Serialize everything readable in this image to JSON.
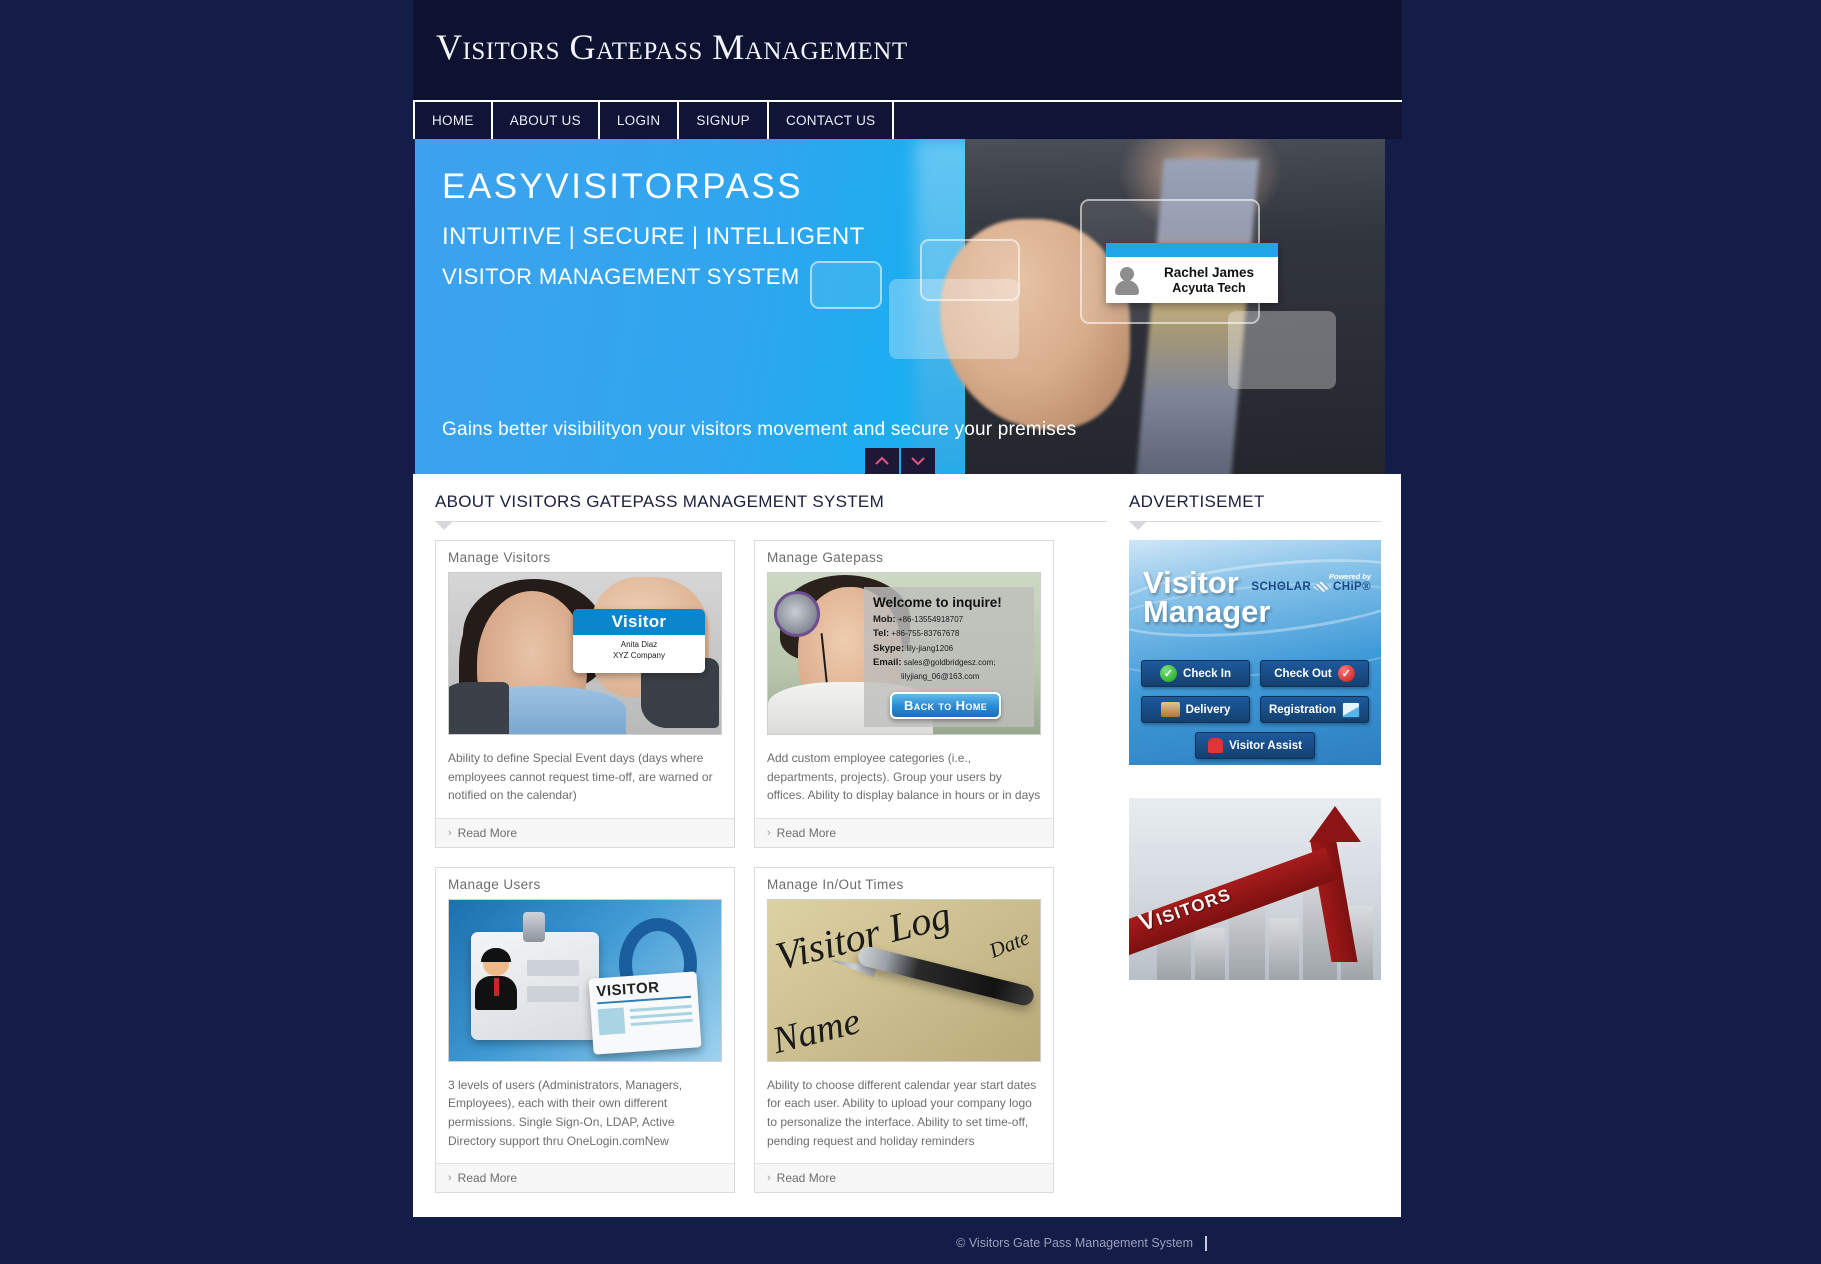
{
  "header": {
    "title": "Visitors Gatepass Management"
  },
  "nav": {
    "items": [
      {
        "label": "HOME"
      },
      {
        "label": "ABOUT US"
      },
      {
        "label": "LOGIN"
      },
      {
        "label": "SIGNUP"
      },
      {
        "label": "CONTACT US"
      }
    ]
  },
  "hero": {
    "title": "EASYVISITORPASS",
    "subtitle1": "INTUITIVE | SECURE | INTELLIGENT",
    "subtitle2": "VISITOR MANAGEMENT SYSTEM",
    "tagline": "Gains better visibilityon your visitors movement and secure your premises",
    "badge": {
      "name": "Rachel James",
      "org": "Acyuta Tech"
    },
    "controls": {
      "prev": "∧",
      "next": "∨"
    }
  },
  "main": {
    "section_title": "ABOUT VISITORS GATEPASS MANAGEMENT SYSTEM",
    "read_more_label": "Read More",
    "chevron": "›",
    "cards": [
      {
        "title": "Manage Visitors",
        "description": "Ability to define Special Event days (days where employees cannot request time-off, are warned or notified on the calendar)",
        "image": {
          "alt": "woman-holding-visitor-card",
          "card_label": "Visitor",
          "card_name": "Anita Diaz",
          "card_org": "XYZ Company"
        }
      },
      {
        "title": "Manage Gatepass",
        "description": "Add custom employee categories (i.e., departments, projects). Group your users by offices. Ability to display balance in hours or in days",
        "image": {
          "alt": "call-center-agent-inquire-panel",
          "heading": "Welcome to inquire!",
          "mob_label": "Mob:",
          "mob": "+86-13554918707",
          "tel_label": "Tel:",
          "tel": "+86-755-83767678",
          "skype_label": "Skype:",
          "skype": "lily-jiang1206",
          "email_label": "Email:",
          "email1": "sales@goldbridgesz.com;",
          "email2": "lilyjiang_06@163.com",
          "button": "Back to Home"
        }
      },
      {
        "title": "Manage Users",
        "description": "3 levels of users (Administrators, Managers, Employees), each with their own different permissions. Single Sign-On, LDAP, Active Directory support thru OneLogin.comNew",
        "image": {
          "alt": "id-badge-lanyard",
          "badge_label": "VISITOR"
        }
      },
      {
        "title": "Manage In/Out Times",
        "description": "Ability to choose different calendar year start dates for each user. Ability to upload your company logo to personalize the interface. Ability to set time-off, pending request and holiday reminders",
        "image": {
          "alt": "visitor-log-ledger-pen",
          "word1": "Visitor Log",
          "word2": "Date",
          "word3": "Name"
        }
      }
    ]
  },
  "sidebar": {
    "section_title": "ADVERTISEMET",
    "ad1": {
      "alt": "visitor-manager-advertisement",
      "title_line1": "Visitor",
      "title_line2": "Manager",
      "powered_by": "Powered by",
      "brand1": "SCHΘLAR",
      "brand2": "CHiP®",
      "buttons": [
        {
          "label": "Check In",
          "icon": "check-circle-green-icon"
        },
        {
          "label": "Check Out",
          "icon": "check-circle-red-icon"
        },
        {
          "label": "Delivery",
          "icon": "package-box-icon"
        },
        {
          "label": "Registration",
          "icon": "registration-form-icon"
        },
        {
          "label": "Visitor Assist",
          "icon": "alarm-light-icon"
        }
      ]
    },
    "ad2": {
      "alt": "visitors-growth-chart-advertisement",
      "arrow_label": "Visitors"
    }
  },
  "footer": {
    "copyright": "© Visitors Gate Pass Management System"
  },
  "colors": {
    "page_bg": "#141c48",
    "header_bg": "#0e1231",
    "nav_bg": "#101437",
    "hero_blue": "#2fa6ef",
    "accent_red": "#8c1414"
  }
}
